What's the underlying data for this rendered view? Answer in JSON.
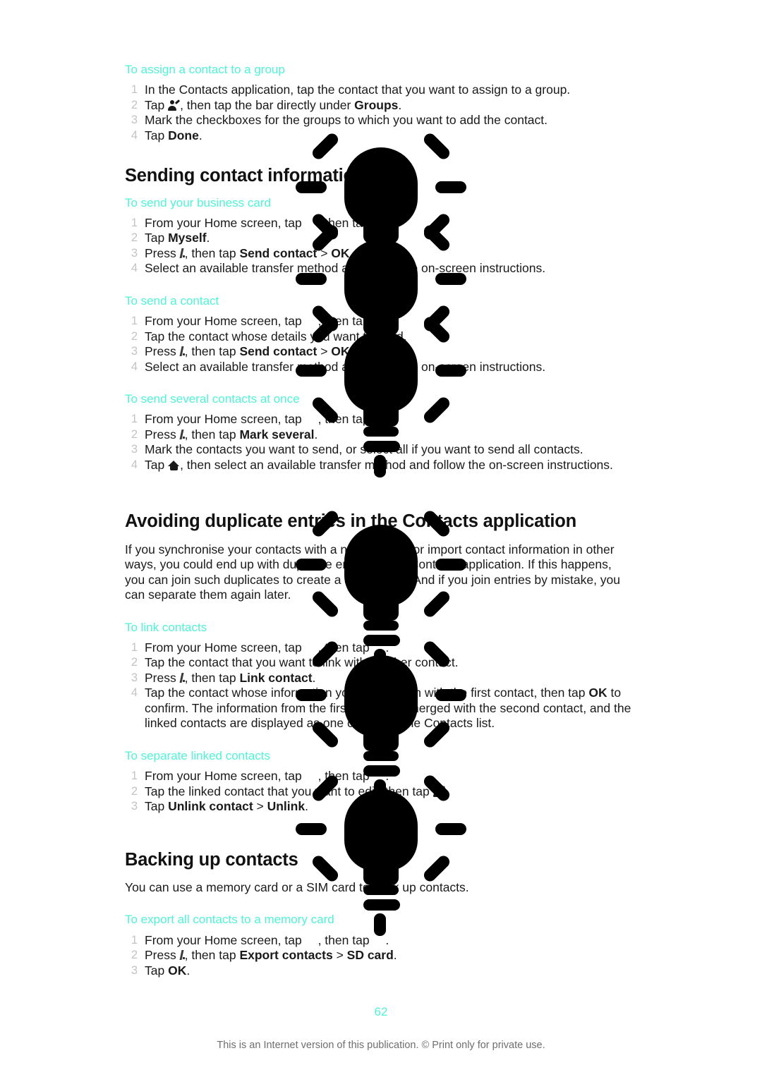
{
  "document": {
    "page_number": "62",
    "footer_note": "This is an Internet version of this publication. © Print only for private use.",
    "heading_color": "#4ff4d4",
    "body_color": "#1a1a1a",
    "step_number_color": "#c3c3c3",
    "watermark_color": "#000000"
  },
  "sections": {
    "assign_group": {
      "subheading": "To assign a contact to a group",
      "steps": [
        {
          "before": "In the Contacts application, tap the contact that you want to assign to a group.",
          "icon": "",
          "after": ""
        },
        {
          "before": "Tap ",
          "icon": "contact-edit-icon",
          "after": ", then tap the bar directly under Groups."
        },
        {
          "before": "Mark the checkboxes for the groups to which you want to add the contact.",
          "icon": "",
          "after": ""
        },
        {
          "before": "Tap Done.",
          "icon": "",
          "after": ""
        }
      ]
    },
    "sending_contact_information": {
      "heading": "Sending contact information",
      "business_card": {
        "subheading": "To send your business card",
        "steps": [
          {
            "text": "From your Home screen, tap  , then tap  ."
          },
          {
            "text": "Tap Myself."
          },
          {
            "text": "Press , then tap Send contact > OK."
          },
          {
            "text": "Select an available transfer method and follow the on-screen instructions."
          }
        ]
      },
      "send_contact": {
        "subheading": "To send a contact",
        "steps": [
          {
            "text": "From your Home screen, tap  , then tap  ."
          },
          {
            "text": "Tap the contact whose details you want to send."
          },
          {
            "text": "Press , then tap Send contact > OK."
          },
          {
            "text": "Select an available transfer method and follow the on-screen instructions."
          }
        ]
      },
      "send_several": {
        "subheading": "To send several contacts at once",
        "steps": [
          {
            "text": "From your Home screen, tap  , then tap  ."
          },
          {
            "text": "Press , then tap Mark several."
          },
          {
            "text": "Mark the contacts you want to send, or select all if you want to send all contacts."
          },
          {
            "text": "Tap  , then select an available transfer method and follow the on-screen instructions."
          }
        ]
      }
    },
    "avoiding_duplicates": {
      "heading": "Avoiding duplicate entries in the Contacts application",
      "paragraph": "If you synchronise your contacts with a new account or import contact information in other ways, you could end up with duplicate entries in the Contacts application. If this happens, you can join such duplicates to create a single entry. And if you join entries by mistake, you can separate them again later.",
      "link_contacts": {
        "subheading": "To link contacts",
        "steps": [
          {
            "text": "From your Home screen, tap  , then tap  ."
          },
          {
            "text": "Tap the contact that you want to link with another contact."
          },
          {
            "text": "Press , then tap Link contact."
          },
          {
            "text": "Tap the contact whose information you want to join with the first contact, then tap OK to confirm. The information from the first contact is merged with the second contact, and the linked contacts are displayed as one contact in the Contacts list."
          }
        ]
      },
      "separate_contacts": {
        "subheading": "To separate linked contacts",
        "steps": [
          {
            "text": "From your Home screen, tap  , then tap  ."
          },
          {
            "text": "Tap the linked contact that you want to edit, then tap  ."
          },
          {
            "text": "Tap Unlink contact > Unlink."
          }
        ]
      }
    },
    "backing_up": {
      "heading": "Backing up contacts",
      "paragraph": "You can use a memory card or a SIM card to back up contacts.",
      "export": {
        "subheading": "To export all contacts to a memory card",
        "steps": [
          {
            "text": "From your Home screen, tap  , then tap  ."
          },
          {
            "text": "Press , then tap Export contacts > SD card."
          },
          {
            "text": "Tap OK."
          }
        ]
      }
    }
  },
  "text_fragments": {
    "assign_1": "In the Contacts application, tap the contact that you want to assign to a group.",
    "assign_2_pre": "Tap ",
    "assign_2_post": ", then tap the bar directly under ",
    "assign_2_bold": "Groups",
    "assign_2_end": ".",
    "assign_3": "Mark the checkboxes for the groups to which you want to add the contact.",
    "assign_4_pre": "Tap ",
    "assign_4_bold": "Done",
    "assign_4_end": ".",
    "home_tap_pre": "From your Home screen, tap ",
    "home_tap_mid": ", then tap ",
    "home_tap_end": ".",
    "press_pre": "Press ",
    "press_mid": ", then tap ",
    "myself_pre": "Tap ",
    "myself_bold": "Myself",
    "myself_end": ".",
    "send_contact_bold": "Send contact",
    "gt": " > ",
    "ok_bold": "OK",
    "period": ".",
    "transfer_method": "Select an available transfer method and follow the on-screen instructions.",
    "send_contact_2": "Tap the contact whose details you want to send.",
    "mark_several_bold": "Mark several",
    "mark_contacts": "Mark the contacts you want to send, or select all if you want to send all contacts.",
    "tap_home_pre": "Tap ",
    "tap_home_post": ", then select an available transfer method and follow the on-screen instructions.",
    "link_2": "Tap the contact that you want to link with another contact.",
    "link_contact_bold": "Link contact",
    "link_4": "Tap the contact whose information you want to join with the first contact, then tap ",
    "link_4_bold": "OK",
    "link_4_rest": " to confirm. The information from the first contact is merged with the second contact, and the linked contacts are displayed as one contact in the Contacts list.",
    "separate_2_pre": "Tap the linked contact that you want to edit, then tap ",
    "separate_2_end": ".",
    "unlink_pre": "Tap ",
    "unlink_bold_1": "Unlink contact",
    "unlink_bold_2": "Unlink",
    "export_contacts_bold": "Export contacts",
    "sd_card_bold": "SD card",
    "tap_ok_pre": "Tap ",
    "tap_ok_bold": "OK"
  }
}
